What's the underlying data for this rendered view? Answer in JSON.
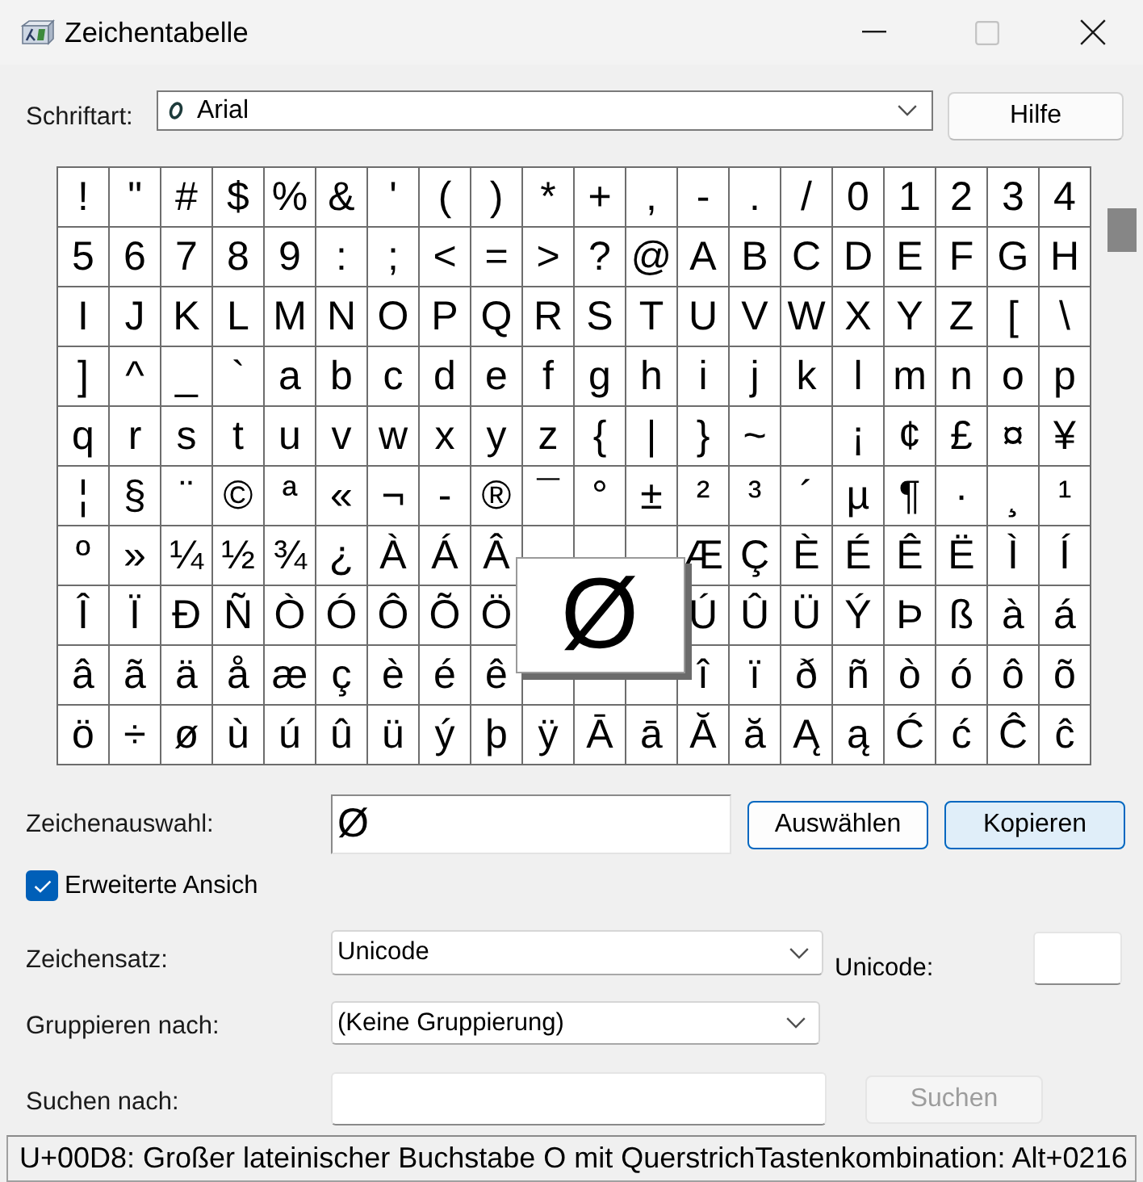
{
  "window": {
    "title": "Zeichentabelle",
    "maximize_disabled": true
  },
  "font": {
    "label": "Schriftart:",
    "value": "Arial"
  },
  "help_button": "Hilfe",
  "grid": {
    "rows": [
      [
        {
          "char": "!",
          "selected": false
        },
        {
          "char": "\"",
          "selected": false
        },
        {
          "char": "#",
          "selected": false
        },
        {
          "char": "$",
          "selected": false
        },
        {
          "char": "%",
          "selected": false
        },
        {
          "char": "&",
          "selected": false
        },
        {
          "char": "'",
          "selected": false
        },
        {
          "char": "(",
          "selected": false
        },
        {
          "char": ")",
          "selected": false
        },
        {
          "char": "*",
          "selected": false
        },
        {
          "char": "+",
          "selected": false
        },
        {
          "char": ",",
          "selected": false
        },
        {
          "char": "-",
          "selected": false
        },
        {
          "char": ".",
          "selected": false
        },
        {
          "char": "/",
          "selected": false
        },
        {
          "char": "0",
          "selected": false
        },
        {
          "char": "1",
          "selected": false
        },
        {
          "char": "2",
          "selected": false
        },
        {
          "char": "3",
          "selected": false
        },
        {
          "char": "4",
          "selected": false
        }
      ],
      [
        {
          "char": "5",
          "selected": false
        },
        {
          "char": "6",
          "selected": false
        },
        {
          "char": "7",
          "selected": false
        },
        {
          "char": "8",
          "selected": false
        },
        {
          "char": "9",
          "selected": false
        },
        {
          "char": ":",
          "selected": false
        },
        {
          "char": ";",
          "selected": false
        },
        {
          "char": "<",
          "selected": false
        },
        {
          "char": "=",
          "selected": false
        },
        {
          "char": ">",
          "selected": false
        },
        {
          "char": "?",
          "selected": false
        },
        {
          "char": "@",
          "selected": false
        },
        {
          "char": "A",
          "selected": false
        },
        {
          "char": "B",
          "selected": false
        },
        {
          "char": "C",
          "selected": false
        },
        {
          "char": "D",
          "selected": false
        },
        {
          "char": "E",
          "selected": false
        },
        {
          "char": "F",
          "selected": false
        },
        {
          "char": "G",
          "selected": false
        },
        {
          "char": "H",
          "selected": false
        }
      ],
      [
        {
          "char": "I",
          "selected": false
        },
        {
          "char": "J",
          "selected": false
        },
        {
          "char": "K",
          "selected": false
        },
        {
          "char": "L",
          "selected": false
        },
        {
          "char": "M",
          "selected": false
        },
        {
          "char": "N",
          "selected": false
        },
        {
          "char": "O",
          "selected": false
        },
        {
          "char": "P",
          "selected": false
        },
        {
          "char": "Q",
          "selected": false
        },
        {
          "char": "R",
          "selected": false
        },
        {
          "char": "S",
          "selected": false
        },
        {
          "char": "T",
          "selected": false
        },
        {
          "char": "U",
          "selected": false
        },
        {
          "char": "V",
          "selected": false
        },
        {
          "char": "W",
          "selected": false
        },
        {
          "char": "X",
          "selected": false
        },
        {
          "char": "Y",
          "selected": false
        },
        {
          "char": "Z",
          "selected": false
        },
        {
          "char": "[",
          "selected": false
        },
        {
          "char": "\\",
          "selected": false
        }
      ],
      [
        {
          "char": "]",
          "selected": false
        },
        {
          "char": "^",
          "selected": false
        },
        {
          "char": "_",
          "selected": false
        },
        {
          "char": "`",
          "selected": false
        },
        {
          "char": "a",
          "selected": false
        },
        {
          "char": "b",
          "selected": false
        },
        {
          "char": "c",
          "selected": false
        },
        {
          "char": "d",
          "selected": false
        },
        {
          "char": "e",
          "selected": false
        },
        {
          "char": "f",
          "selected": false
        },
        {
          "char": "g",
          "selected": false
        },
        {
          "char": "h",
          "selected": false
        },
        {
          "char": "i",
          "selected": false
        },
        {
          "char": "j",
          "selected": false
        },
        {
          "char": "k",
          "selected": false
        },
        {
          "char": "l",
          "selected": false
        },
        {
          "char": "m",
          "selected": false
        },
        {
          "char": "n",
          "selected": false
        },
        {
          "char": "o",
          "selected": false
        },
        {
          "char": "p",
          "selected": false
        }
      ],
      [
        {
          "char": "q",
          "selected": false
        },
        {
          "char": "r",
          "selected": false
        },
        {
          "char": "s",
          "selected": false
        },
        {
          "char": "t",
          "selected": false
        },
        {
          "char": "u",
          "selected": false
        },
        {
          "char": "v",
          "selected": false
        },
        {
          "char": "w",
          "selected": false
        },
        {
          "char": "x",
          "selected": false
        },
        {
          "char": "y",
          "selected": false
        },
        {
          "char": "z",
          "selected": false
        },
        {
          "char": "{",
          "selected": false
        },
        {
          "char": "|",
          "selected": false
        },
        {
          "char": "}",
          "selected": false
        },
        {
          "char": "~",
          "selected": false
        },
        null,
        {
          "char": "¡",
          "selected": false
        },
        {
          "char": "¢",
          "selected": false
        },
        {
          "char": "£",
          "selected": false
        },
        {
          "char": "¤",
          "selected": false
        },
        {
          "char": "¥",
          "selected": false
        }
      ],
      [
        {
          "char": "¦",
          "selected": false
        },
        {
          "char": "§",
          "selected": false
        },
        {
          "char": "¨",
          "selected": false
        },
        {
          "char": "©",
          "selected": false
        },
        {
          "char": "ª",
          "selected": false
        },
        {
          "char": "«",
          "selected": false
        },
        {
          "char": "¬",
          "selected": false
        },
        {
          "char": "-",
          "selected": false
        },
        {
          "char": "®",
          "selected": false
        },
        {
          "char": "¯",
          "selected": false
        },
        {
          "char": "°",
          "selected": false
        },
        {
          "char": "±",
          "selected": false
        },
        {
          "char": "²",
          "selected": false
        },
        {
          "char": "³",
          "selected": false
        },
        {
          "char": "´",
          "selected": false
        },
        {
          "char": "µ",
          "selected": false
        },
        {
          "char": "¶",
          "selected": false
        },
        {
          "char": "·",
          "selected": false
        },
        {
          "char": "¸",
          "selected": false
        },
        {
          "char": "¹",
          "selected": false
        }
      ],
      [
        {
          "char": "º",
          "selected": false
        },
        {
          "char": "»",
          "selected": false
        },
        {
          "char": "¼",
          "selected": false
        },
        {
          "char": "½",
          "selected": false
        },
        {
          "char": "¾",
          "selected": false
        },
        {
          "char": "¿",
          "selected": false
        },
        {
          "char": "À",
          "selected": false
        },
        {
          "char": "Á",
          "selected": false
        },
        {
          "char": "Â",
          "selected": false
        },
        null,
        null,
        null,
        {
          "char": "Æ",
          "selected": false
        },
        {
          "char": "Ç",
          "selected": false
        },
        {
          "char": "È",
          "selected": false
        },
        {
          "char": "É",
          "selected": false
        },
        {
          "char": "Ê",
          "selected": false
        },
        {
          "char": "Ë",
          "selected": false
        },
        {
          "char": "Ì",
          "selected": false
        },
        {
          "char": "Í",
          "selected": false
        }
      ],
      [
        {
          "char": "Î",
          "selected": false
        },
        {
          "char": "Ï",
          "selected": false
        },
        {
          "char": "Ð",
          "selected": false
        },
        {
          "char": "Ñ",
          "selected": false
        },
        {
          "char": "Ò",
          "selected": false
        },
        {
          "char": "Ó",
          "selected": false
        },
        {
          "char": "Ô",
          "selected": false
        },
        {
          "char": "Õ",
          "selected": false
        },
        {
          "char": "Ö",
          "selected": false
        },
        null,
        {
          "char": "Ø",
          "selected": true
        },
        null,
        {
          "char": "Ú",
          "selected": false
        },
        {
          "char": "Û",
          "selected": false
        },
        {
          "char": "Ü",
          "selected": false
        },
        {
          "char": "Ý",
          "selected": false
        },
        {
          "char": "Þ",
          "selected": false
        },
        {
          "char": "ß",
          "selected": false
        },
        {
          "char": "à",
          "selected": false
        },
        {
          "char": "á",
          "selected": false
        }
      ],
      [
        {
          "char": "â",
          "selected": false
        },
        {
          "char": "ã",
          "selected": false
        },
        {
          "char": "ä",
          "selected": false
        },
        {
          "char": "å",
          "selected": false
        },
        {
          "char": "æ",
          "selected": false
        },
        {
          "char": "ç",
          "selected": false
        },
        {
          "char": "è",
          "selected": false
        },
        {
          "char": "é",
          "selected": false
        },
        {
          "char": "ê",
          "selected": false
        },
        null,
        null,
        null,
        {
          "char": "î",
          "selected": false
        },
        {
          "char": "ï",
          "selected": false
        },
        {
          "char": "ð",
          "selected": false
        },
        {
          "char": "ñ",
          "selected": false
        },
        {
          "char": "ò",
          "selected": false
        },
        {
          "char": "ó",
          "selected": false
        },
        {
          "char": "ô",
          "selected": false
        },
        {
          "char": "õ",
          "selected": false
        }
      ],
      [
        {
          "char": "ö",
          "selected": false
        },
        {
          "char": "÷",
          "selected": false
        },
        {
          "char": "ø",
          "selected": false
        },
        {
          "char": "ù",
          "selected": false
        },
        {
          "char": "ú",
          "selected": false
        },
        {
          "char": "û",
          "selected": false
        },
        {
          "char": "ü",
          "selected": false
        },
        {
          "char": "ý",
          "selected": false
        },
        {
          "char": "þ",
          "selected": false
        },
        {
          "char": "ÿ",
          "selected": false
        },
        {
          "char": "Ā",
          "selected": false
        },
        {
          "char": "ā",
          "selected": false
        },
        {
          "char": "Ă",
          "selected": false
        },
        {
          "char": "ă",
          "selected": false
        },
        {
          "char": "Ą",
          "selected": false
        },
        {
          "char": "ą",
          "selected": false
        },
        {
          "char": "Ć",
          "selected": false
        },
        {
          "char": "ć",
          "selected": false
        },
        {
          "char": "Ĉ",
          "selected": false
        },
        {
          "char": "ĉ",
          "selected": false
        }
      ]
    ]
  },
  "selection": {
    "label": "Zeichenauswahl:",
    "value": "Ø",
    "buttons": [
      {
        "label": "Auswählen",
        "hovered": false
      },
      {
        "label": "Kopieren",
        "hovered": true
      }
    ]
  },
  "advanced_view": {
    "label": "Erweiterte Ansich",
    "checked": true
  },
  "character_set": {
    "label": "Zeichensatz:",
    "value": "Unicode"
  },
  "unicode": {
    "label": "Unicode:"
  },
  "group_by": {
    "label": "Gruppieren nach:",
    "value": "(Keine Gruppierung)"
  },
  "search": {
    "label": "Suchen nach:",
    "button": {
      "label": "Suchen",
      "disabled": true
    }
  },
  "status_bar": "U+00D8: Großer lateinischer Buchstabe O mit QuerstrichTastenkombination: Alt+0216"
}
